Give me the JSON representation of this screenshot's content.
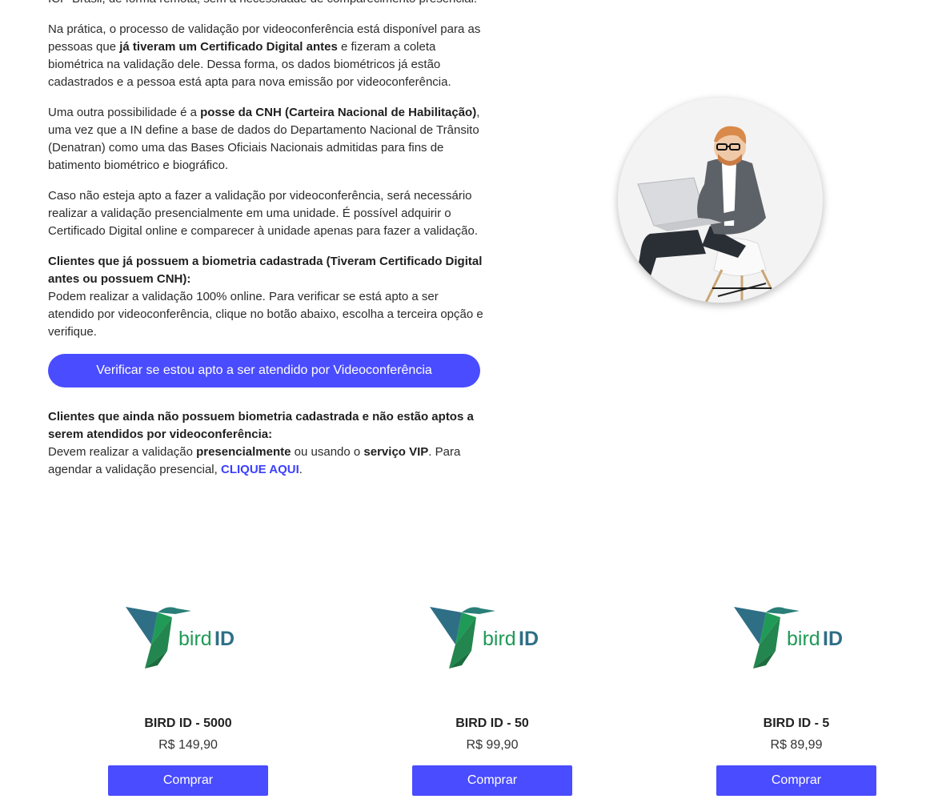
{
  "intro": {
    "p0": "ICP-Brasil, de forma remota, sem a necessidade de comparecimento presencial.",
    "p1_a": "Na prática, o processo de validação por videoconferência está disponível para as pessoas que ",
    "p1_b": "já tiveram um Certificado Digital antes",
    "p1_c": " e fizeram a coleta biométrica na validação dele. Dessa forma, os dados biométricos já estão cadastrados e a pessoa está apta para nova emissão por videoconferência.",
    "p2_a": "Uma outra possibilidade é a ",
    "p2_b": "posse da CNH (Carteira Nacional de Habilitação)",
    "p2_c": ", uma vez que a IN define a base de dados do Departamento Nacional de Trânsito (Denatran) como uma das Bases Oficiais Nacionais admitidas para fins de batimento biométrico e biográfico.",
    "p3": "Caso não esteja apto a fazer a validação por videoconferência, será necessário realizar a validação presencialmente em uma unidade. É possível adquirir o Certificado Digital online e comparecer à unidade apenas para fazer a validação.",
    "p4_title": "Clientes que já possuem a biometria cadastrada (Tiveram Certificado Digital antes ou possuem CNH):",
    "p4_text": "Podem realizar a validação 100% online. Para verificar se está apto a ser atendido por videoconferência, clique no botão abaixo, escolha a terceira opção e verifique.",
    "cta_label": "Verificar se estou apto a ser atendido por Videoconferência",
    "p5_title": "Clientes que ainda não possuem biometria cadastrada e não estão aptos a serem atendidos por videoconferência:",
    "p5_a": "Devem realizar a validação ",
    "p5_b": "presencialmente",
    "p5_c": " ou usando o ",
    "p5_d": "serviço VIP",
    "p5_e": ". Para agendar a validação presencial, ",
    "p5_link": "CLIQUE AQUI",
    "p5_f": "."
  },
  "logo_text": {
    "bird": "bird",
    "id": "ID"
  },
  "products": [
    {
      "name": "BIRD ID - 5000",
      "price": "R$ 149,90",
      "buy": "Comprar"
    },
    {
      "name": "BIRD ID - 50",
      "price": "R$ 99,90",
      "buy": "Comprar"
    },
    {
      "name": "BIRD ID - 5",
      "price": "R$ 89,99",
      "buy": "Comprar"
    }
  ],
  "colors": {
    "accent": "#4a4cff",
    "link": "#3b3fff",
    "logo_green": "#1f9a57",
    "logo_teal": "#2e6f86"
  }
}
